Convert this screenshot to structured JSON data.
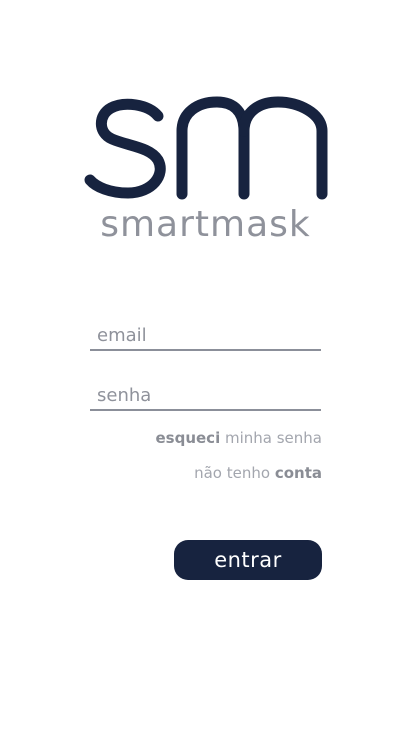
{
  "brand": {
    "logo_mark": "sm",
    "name": "smartmask",
    "color_primary": "#17233f",
    "color_muted": "#8f929b"
  },
  "login": {
    "email_placeholder": "email",
    "email_value": "",
    "password_placeholder": "senha",
    "password_value": "",
    "forgot_bold": "esqueci",
    "forgot_rest": " minha senha",
    "signup_rest": "não tenho ",
    "signup_bold": "conta",
    "submit_label": "entrar"
  }
}
